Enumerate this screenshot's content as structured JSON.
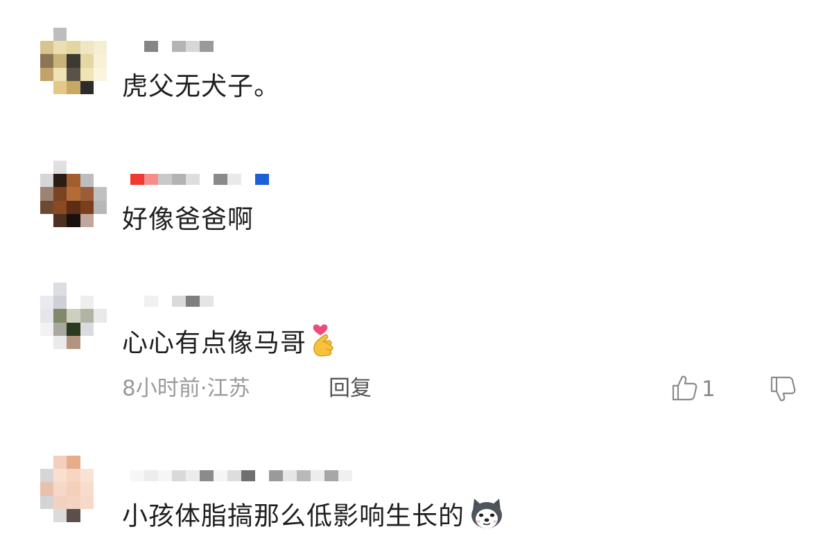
{
  "comments": [
    {
      "text": "虎父无犬子。",
      "avatar": [
        "#ffffff",
        "#bdbdbd",
        "#ffffff",
        "#ffffff",
        "#ffffff",
        "#d7c48f",
        "#ebdfb2",
        "#e3d6a2",
        "#efe6c4",
        "#f4eed4",
        "#8c7552",
        "#c9b37a",
        "#3d3a33",
        "#e4d7a4",
        "#f8f1d6",
        "#c1a26a",
        "#efe2b5",
        "#5a5247",
        "#f0e4b7",
        "#fbf5df",
        "#ffffff",
        "#e3c889",
        "#c8a862",
        "#2c2c2c",
        "#ffffff"
      ],
      "username_blocks": [
        "#ffffff",
        "#858585",
        "#ffffff",
        "#b4b4b4",
        "#d7d7d7",
        "#9a9a9a"
      ]
    },
    {
      "text": "好像爸爸啊",
      "avatar": [
        "#ffffff",
        "#e0e0e0",
        "#ffffff",
        "#ffffff",
        "#ffffff",
        "#d6d6d6",
        "#2b1d14",
        "#a35e2e",
        "#bdbdbd",
        "#ffffff",
        "#9c8371",
        "#7a4423",
        "#b36b37",
        "#9b5d38",
        "#c0c0c0",
        "#6c4a31",
        "#8b4a22",
        "#5c2e17",
        "#7c3f1c",
        "#b7b7b7",
        "#ffffff",
        "#4d3020",
        "#1a1010",
        "#c0a799",
        "#ffffff"
      ],
      "username_blocks": [
        "#ef3b2f",
        "#f78d8a",
        "#c9c9c9",
        "#b3b3b3",
        "#dedede",
        "#ffffff",
        "#8a8a8a",
        "#e9e9e9",
        "#ffffff",
        "#1d5fd6"
      ]
    },
    {
      "text": "心心有点像马哥",
      "avatar": [
        "#ffffff",
        "#dcdde3",
        "#ffffff",
        "#ffffff",
        "#ffffff",
        "#e9e9ef",
        "#cfd0d7",
        "#ffffff",
        "#eeeeee",
        "#ffffff",
        "#e6e6ea",
        "#7f8a6a",
        "#ced0bf",
        "#b0b4a5",
        "#e9e9ec",
        "#f2f2f5",
        "#a9a89f",
        "#2c3a22",
        "#dadbe0",
        "#ffffff",
        "#ffffff",
        "#ece9ec",
        "#b3957f",
        "#ffffff",
        "#ffffff"
      ],
      "username_blocks": [
        "#ffffff",
        "#f0f0f0",
        "#ffffff",
        "#dadada",
        "#7f7f7f",
        "#e5e5e5"
      ],
      "meta": "8小时前·江苏",
      "reply_label": "回复",
      "like_count": "1"
    },
    {
      "text": "小孩体脂搞那么低影响生长的",
      "avatar": [
        "#ffffff",
        "#f2d0bd",
        "#e6ad8c",
        "#ffffff",
        "#ffffff",
        "#d6d6d6",
        "#f8dfcf",
        "#f6d6c3",
        "#f9e3d5",
        "#ffffff",
        "#e7c1ad",
        "#f7d8c6",
        "#f4cfb9",
        "#f9dccb",
        "#ffffff",
        "#d4d4d4",
        "#f1d2c0",
        "#f3d4c3",
        "#f6d9c9",
        "#ffffff",
        "#ffffff",
        "#dbdbdb",
        "#5b4f49",
        "#ffffff",
        "#ffffff"
      ],
      "username_blocks": [
        "#f6f6f6",
        "#ededed",
        "#f6f6f6",
        "#d9d9d9",
        "#ececec",
        "#8b8b8b",
        "#f5f5f5",
        "#dddddd",
        "#6f6f6f",
        "#ffffff",
        "#9a9a9a",
        "#e6e6e6",
        "#b9b9b9",
        "#ededed",
        "#a7a7a7",
        "#f0f0f0"
      ]
    }
  ],
  "icons": {
    "emoji_comment3": "finger-heart-emoji",
    "emoji_comment4": "doge-emoji",
    "like": "thumbs-up-icon",
    "dislike": "thumbs-down-icon"
  },
  "colors": {
    "text": "#1f1f1f",
    "meta": "#9a9a9a",
    "reply": "#555555",
    "icon": "#8a8a8a"
  }
}
